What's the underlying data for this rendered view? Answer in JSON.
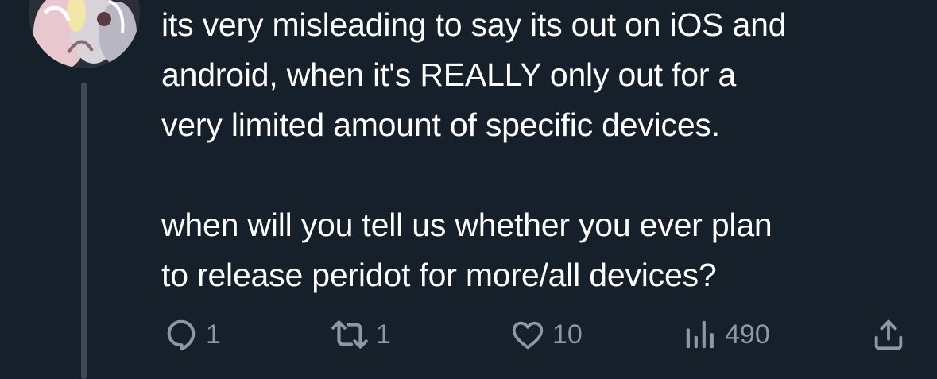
{
  "tweet": {
    "paragraphs": [
      "its very misleading to say its out on iOS and\nandroid, when it's REALLY only out for a\nvery limited amount of specific devices.",
      "when will you tell us whether you ever plan\nto release peridot for more/all devices?"
    ]
  },
  "actions": {
    "reply": {
      "icon": "reply-icon",
      "count": "1"
    },
    "repost": {
      "icon": "repost-icon",
      "count": "1"
    },
    "like": {
      "icon": "heart-icon",
      "count": "10"
    },
    "views": {
      "icon": "views-chart-icon",
      "count": "490"
    },
    "share": {
      "icon": "share-icon"
    }
  },
  "colors": {
    "background": "#15202b",
    "text": "#ffffff",
    "secondary": "#8b98a5",
    "thread_line": "#3d4a56"
  }
}
